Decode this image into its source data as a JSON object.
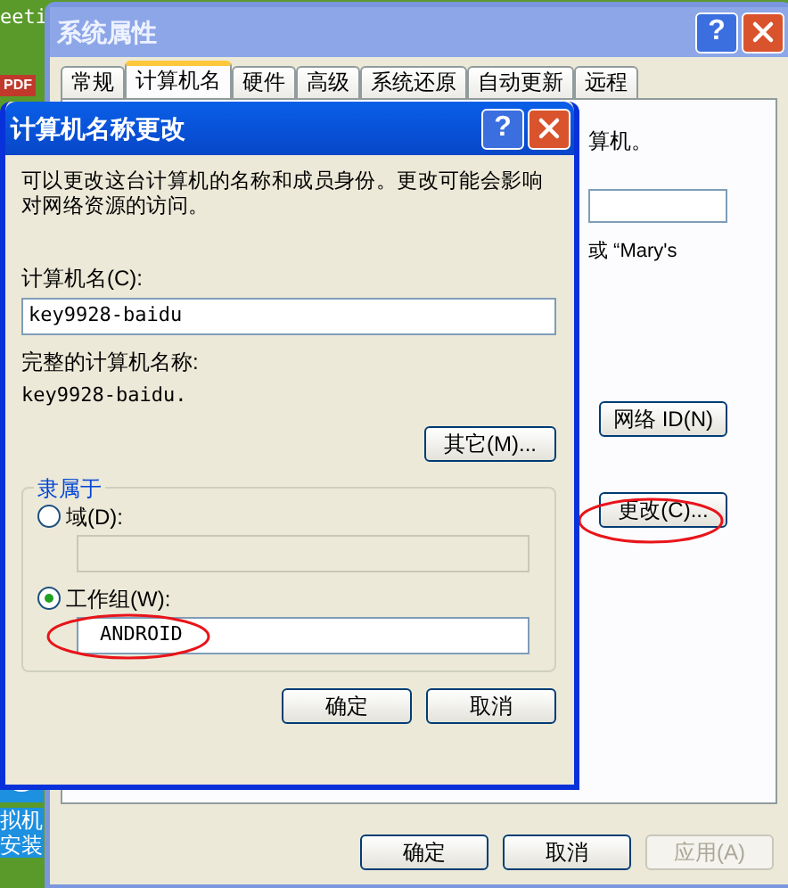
{
  "desktop": {
    "top_label": "eeti",
    "pdf_badge": "PDF",
    "shortcut_label_lines": [
      "拟机",
      "安装"
    ]
  },
  "system_properties": {
    "title": "系统属性",
    "help_button": "?",
    "tabs": [
      {
        "label": "常规",
        "selected": false
      },
      {
        "label": "计算机名",
        "selected": true
      },
      {
        "label": "硬件",
        "selected": false
      },
      {
        "label": "高级",
        "selected": false
      },
      {
        "label": "系统还原",
        "selected": false
      },
      {
        "label": "自动更新",
        "selected": false
      },
      {
        "label": "远程",
        "selected": false
      }
    ],
    "panel_text": "算机。",
    "description_text": "或 “Mary's",
    "network_id_button": "网络 ID(N)",
    "change_button": "更改(C)...",
    "buttons": [
      {
        "label": "确定",
        "disabled": false
      },
      {
        "label": "取消",
        "disabled": false
      },
      {
        "label": "应用(A)",
        "disabled": true
      }
    ]
  },
  "rename_dialog": {
    "title": "计算机名称更改",
    "help_button": "?",
    "description": "可以更改这台计算机的名称和成员身份。更改可能会影响对网络资源的访问。",
    "computer_name_label": "计算机名(C):",
    "computer_name": "key9928-baidu",
    "full_name_label": "完整的计算机名称:",
    "full_name": "key9928-baidu.",
    "more_button": "其它(M)...",
    "member_of": {
      "title": "隶属于",
      "options": [
        {
          "label": "域(D):",
          "selected": false
        },
        {
          "label": "工作组(W):",
          "selected": true,
          "value": "ANDROID"
        }
      ]
    },
    "buttons": [
      "确定",
      "取消"
    ]
  }
}
